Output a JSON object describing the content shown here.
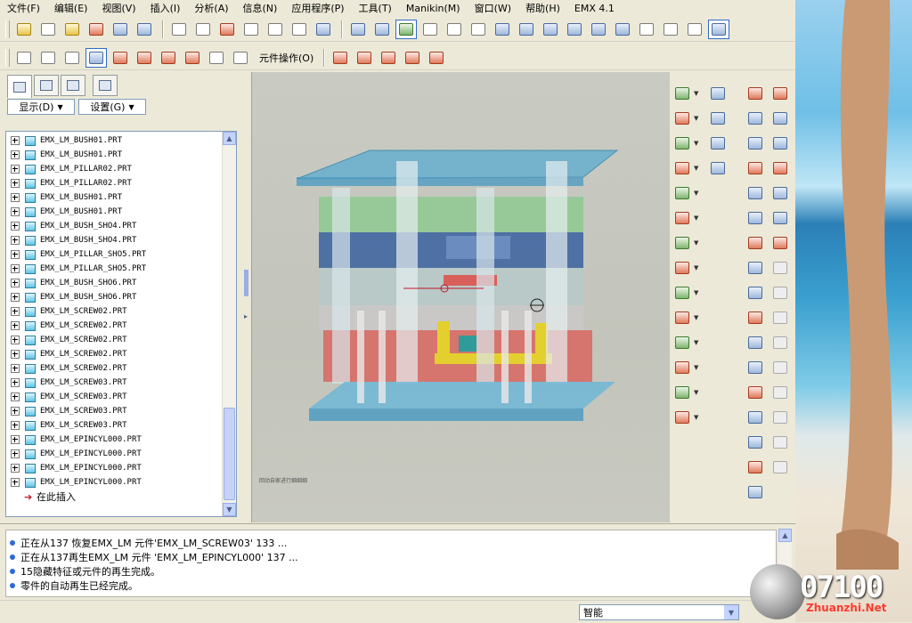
{
  "menubar": [
    "文件(F)",
    "编辑(E)",
    "视图(V)",
    "插入(I)",
    "分析(A)",
    "信息(N)",
    "应用程序(P)",
    "工具(T)",
    "Manikin(M)",
    "窗口(W)",
    "帮助(H)",
    "EMX 4.1"
  ],
  "toolbar2": {
    "component_ops_label": "元件操作(O)"
  },
  "left_panel": {
    "display_dropdown": "显示(D)",
    "settings_dropdown": "设置(G)",
    "tree_items": [
      "EMX_LM_BUSH01.PRT",
      "EMX_LM_BUSH01.PRT",
      "EMX_LM_PILLAR02.PRT",
      "EMX_LM_PILLAR02.PRT",
      "EMX_LM_BUSH01.PRT",
      "EMX_LM_BUSH01.PRT",
      "EMX_LM_BUSH_SHO4.PRT",
      "EMX_LM_BUSH_SHO4.PRT",
      "EMX_LM_PILLAR_SHO5.PRT",
      "EMX_LM_PILLAR_SHO5.PRT",
      "EMX_LM_BUSH_SHO6.PRT",
      "EMX_LM_BUSH_SHO6.PRT",
      "EMX_LM_SCREW02.PRT",
      "EMX_LM_SCREW02.PRT",
      "EMX_LM_SCREW02.PRT",
      "EMX_LM_SCREW02.PRT",
      "EMX_LM_SCREW02.PRT",
      "EMX_LM_SCREW03.PRT",
      "EMX_LM_SCREW03.PRT",
      "EMX_LM_SCREW03.PRT",
      "EMX_LM_SCREW03.PRT",
      "EMX_LM_EPINCYL000.PRT",
      "EMX_LM_EPINCYL000.PRT",
      "EMX_LM_EPINCYL000.PRT",
      "EMX_LM_EPINCYL000.PRT"
    ],
    "insert_here_label": "在此插入"
  },
  "viewport": {
    "note": "回动自家进行细细细"
  },
  "messages": [
    "正在从137 恢复EMX_LM 元件'EMX_LM_SCREW03' 133 ...",
    "正在从137再生EMX_LM 元件 'EMX_LM_EPINCYL000' 137 ...",
    "15隐藏特征或元件的再生完成。",
    "零件的自动再生已经完成。"
  ],
  "status": {
    "filter_value": "智能"
  },
  "watermark": {
    "number": "07100",
    "site": "Zhuanzhi.Net"
  },
  "colors": {
    "selection_blue": "#316ac5",
    "message_bullet": "#2e6ad1",
    "plate_blue": "#5aa9cf",
    "plate_green": "#86c98a",
    "plate_red": "#d9605a",
    "plate_yellow": "#e3cf2e"
  }
}
